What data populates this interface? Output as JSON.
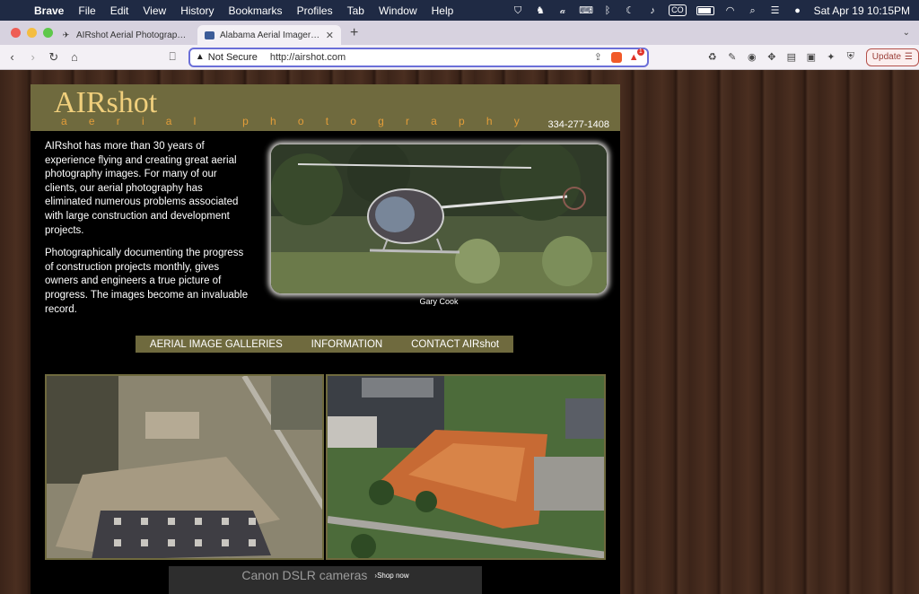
{
  "menubar": {
    "app": "Brave",
    "items": [
      "File",
      "Edit",
      "View",
      "History",
      "Bookmarks",
      "Profiles",
      "Tab",
      "Window",
      "Help"
    ],
    "badge": "CO",
    "datetime": "Sat Apr 19  10:15PM"
  },
  "tabs": [
    {
      "title": "AIRshot Aerial Photography – Drone…",
      "active": false
    },
    {
      "title": "Alabama Aerial Imagery - Mo…",
      "active": true
    }
  ],
  "toolbar": {
    "security": "Not Secure",
    "url": "http://airshot.com",
    "rewards_count": "1",
    "update_label": "Update"
  },
  "site": {
    "logo": "AIRshot",
    "tagline": "aerial photography",
    "phone": "334-277-1408",
    "intro": [
      "AIRshot has more than 30 years of experience flying and creating great aerial photography images. For many of our clients, our aerial photography has eliminated numerous problems associated with large construction and development projects.",
      "Photographically documenting the progress of construction projects monthly, gives owners and engineers a true picture of progress. The images become an invaluable record."
    ],
    "caption": "Gary Cook",
    "nav": [
      "AERIAL IMAGE GALLERIES",
      "INFORMATION",
      "CONTACT AIRshot"
    ],
    "ad": {
      "text": "Canon DSLR cameras",
      "link": "›Shop now"
    }
  },
  "colors": {
    "header_olive": "#6f6a3e",
    "logo_gold": "#f0cf7c",
    "tagline_orange": "#e39d39",
    "url_focus": "#6b6fd8"
  }
}
